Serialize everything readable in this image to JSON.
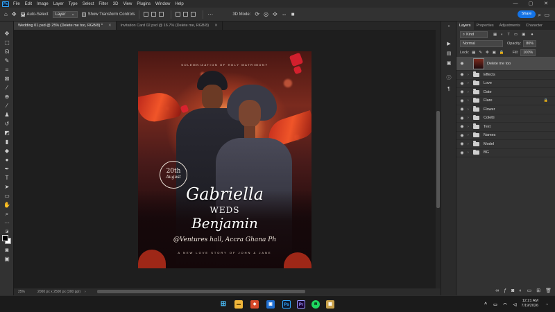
{
  "app": {
    "logo": "Ps"
  },
  "menu": [
    "File",
    "Edit",
    "Image",
    "Layer",
    "Type",
    "Select",
    "Filter",
    "3D",
    "View",
    "Plugins",
    "Window",
    "Help"
  ],
  "window_controls": {
    "minimize": "—",
    "maximize": "▢",
    "close": "✕"
  },
  "options_bar": {
    "auto_select_label": "Auto-Select",
    "target": "Layer",
    "show_transform_label": "Show Transform Controls",
    "mode_3d_label": "3D Mode:",
    "share_label": "Share"
  },
  "tabs": [
    {
      "label": "Wedding 01.psd @ 25% (Delete me too, RGB/8) *"
    },
    {
      "label": "Invitation Card 02.psd @ 16.7% (Delete me, RGB/8)"
    }
  ],
  "status": {
    "zoom": "25%",
    "doc_info": "2000 px x 2500 px (300 ppi)"
  },
  "poster": {
    "top_text": "SOLEMNIZATION OF HOLY MATRIMONY",
    "date_day": "20th",
    "date_month": "August",
    "name1": "Gabriella",
    "weds": "WEDS",
    "name2": "Benjamin",
    "venue": "@Ventures hall, Accra Ghana Ph",
    "tagline": "A NEW LOVE STORY OF JOHN & JANE"
  },
  "panel": {
    "tabs": [
      "Layers",
      "Properties",
      "Adjustments",
      "Character"
    ],
    "filter_kind": "Kind",
    "blend_mode": "Normal",
    "opacity_label": "Opacity:",
    "opacity_value": "80%",
    "lock_label": "Lock:",
    "fill_label": "Fill:",
    "fill_value": "100%",
    "layers": [
      {
        "name": "Delete me too",
        "type": "layer",
        "selected": true
      },
      {
        "name": "Effects",
        "type": "group"
      },
      {
        "name": "Love",
        "type": "group"
      },
      {
        "name": "Date",
        "type": "group"
      },
      {
        "name": "Flare",
        "type": "group",
        "locked": true
      },
      {
        "name": "Flower",
        "type": "group"
      },
      {
        "name": "Coletti",
        "type": "group"
      },
      {
        "name": "Text",
        "type": "group"
      },
      {
        "name": "Names",
        "type": "group"
      },
      {
        "name": "Model",
        "type": "group"
      },
      {
        "name": "BG",
        "type": "group"
      }
    ]
  },
  "taskbar": {
    "time": "12:21 AM",
    "date": "7/19/2026"
  },
  "colors": {
    "accent": "#1473e6",
    "panel": "#323232",
    "canvas": "#1e1e1e"
  }
}
